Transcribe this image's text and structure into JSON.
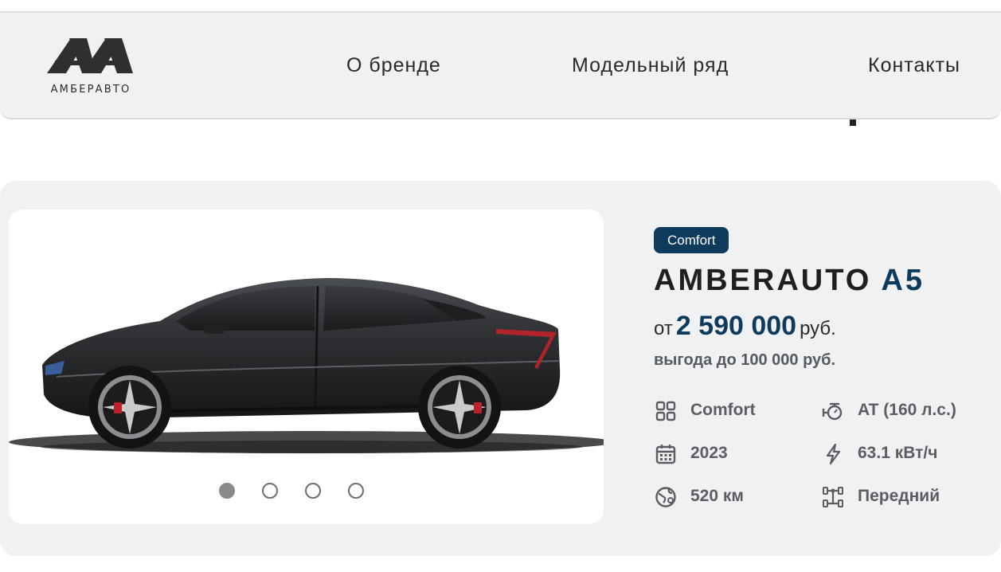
{
  "header": {
    "logo_text": "АМБЕРАВТО",
    "nav": [
      {
        "label": "О бренде"
      },
      {
        "label": "Модельный ряд"
      },
      {
        "label": "Контакты"
      }
    ]
  },
  "product": {
    "badge": "Comfort",
    "model_brand": "AMBERAUTO",
    "model_name": "A5",
    "price_prefix": "от",
    "price_value": "2 590 000",
    "price_currency": "руб.",
    "benefit": "выгода до 100 000 руб.",
    "carousel": {
      "count": 4,
      "active_index": 0
    },
    "specs": [
      {
        "icon": "trim-grid-icon",
        "text": "Comfort"
      },
      {
        "icon": "engine-icon",
        "text": "AT (160 л.с.)"
      },
      {
        "icon": "calendar-icon",
        "text": "2023"
      },
      {
        "icon": "lightning-icon",
        "text": "63.1 кВт/ч"
      },
      {
        "icon": "range-globe-icon",
        "text": "520 км"
      },
      {
        "icon": "drivetrain-icon",
        "text": "Передний"
      }
    ]
  },
  "colors": {
    "accent": "#0e3a5c",
    "card_background": "#f0f1f3",
    "spec_text": "#5a5e63"
  }
}
